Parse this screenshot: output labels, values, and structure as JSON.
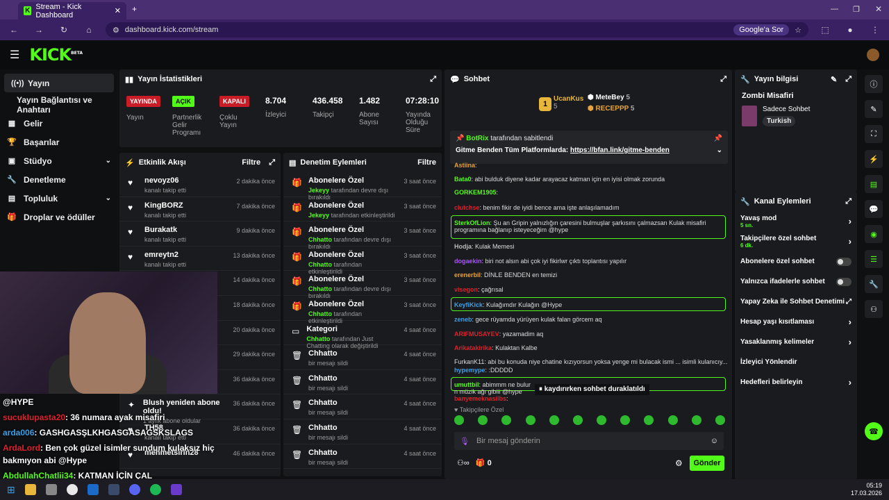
{
  "browser": {
    "tab_title": "Stream - Kick Dashboard",
    "url": "dashboard.kick.com/stream",
    "search_chip": "Google'a Sor"
  },
  "header": {
    "logo": "KICK",
    "beta": "BETA"
  },
  "sidebar": {
    "items": [
      {
        "label": "Yayın",
        "icon": "broadcast-icon"
      },
      {
        "label": "Yayın Bağlantısı ve Anahtarı"
      },
      {
        "label": "Gelir",
        "icon": "revenue-icon"
      },
      {
        "label": "Başarılar",
        "icon": "trophy-icon"
      },
      {
        "label": "Stüdyo",
        "icon": "studio-icon"
      },
      {
        "label": "Denetleme",
        "icon": "wrench-icon"
      },
      {
        "label": "Topluluk",
        "icon": "community-icon"
      },
      {
        "label": "Droplar ve ödüller",
        "icon": "gift-icon"
      }
    ]
  },
  "stats": {
    "title": "Yayın İstatistikleri",
    "items": [
      {
        "badge": "YAYINDA",
        "label": "Yayın",
        "color": "#e0202a"
      },
      {
        "badge": "AÇIK",
        "label": "Partnerlik Gelir Programı",
        "color": "#53fc18"
      },
      {
        "badge": "KAPALI",
        "label": "Çoklu Yayın",
        "color": "#e0202a"
      },
      {
        "value": "8.704",
        "label": "İzleyici"
      },
      {
        "value": "436.458",
        "label": "Takipçi"
      },
      {
        "value": "1.482",
        "label": "Abone Sayısı"
      },
      {
        "value": "07:28:10",
        "label": "Yayında Olduğu Süre"
      }
    ]
  },
  "activity": {
    "title": "Etkinlik Akışı",
    "filter": "Filtre",
    "rows": [
      {
        "name": "nevoyz06",
        "sub": "kanalı takip etti",
        "time": "2 dakika önce"
      },
      {
        "name": "KingBORZ",
        "sub": "kanalı takip etti",
        "time": "7 dakika önce"
      },
      {
        "name": "Burakatk",
        "sub": "kanalı takip etti",
        "time": "9 dakika önce"
      },
      {
        "name": "emreytn2",
        "sub": "kanalı takip etti",
        "time": "13 dakika önce"
      },
      {
        "name": "",
        "sub": "",
        "time": "14 dakika önce"
      },
      {
        "name": "",
        "sub": "",
        "time": "18 dakika önce"
      },
      {
        "name": "",
        "sub": "",
        "time": "20 dakika önce"
      },
      {
        "name": "",
        "sub": "",
        "time": "29 dakika önce"
      },
      {
        "name": "lu!",
        "sub": "",
        "time": "36 dakika önce"
      },
      {
        "name": "Blush yeniden abone oldu!",
        "sub": "1 aylık abone oldular",
        "time": "36 dakika önce"
      },
      {
        "name": "TH58",
        "sub": "kanalı takip etti",
        "time": "36 dakika önce"
      },
      {
        "name": "mehmetsirin28",
        "sub": "",
        "time": "46 dakika önce"
      }
    ]
  },
  "moderation": {
    "title": "Denetim Eylemleri",
    "filter": "Filtre",
    "rows": [
      {
        "name": "Abonelere Özel",
        "user": "Jekeyy",
        "sub": "tarafından devre dışı bırakıldı",
        "time": "3 saat önce"
      },
      {
        "name": "Abonelere Özel",
        "user": "Jekeyy",
        "sub": "tarafından etkinleştirildi",
        "time": "3 saat önce"
      },
      {
        "name": "Abonelere Özel",
        "user": "Chhatto",
        "sub": "tarafından devre dışı bırakıldı",
        "time": "3 saat önce"
      },
      {
        "name": "Abonelere Özel",
        "user": "Chhatto",
        "sub": "tarafından etkinleştirildi",
        "time": "3 saat önce"
      },
      {
        "name": "Abonelere Özel",
        "user": "Chhatto",
        "sub": "tarafından devre dışı bırakıldı",
        "time": "3 saat önce"
      },
      {
        "name": "Abonelere Özel",
        "user": "Chhatto",
        "sub": "tarafından etkinleştirildi",
        "time": "3 saat önce"
      },
      {
        "name": "Kategori",
        "user": "Chhatto",
        "sub": "tarafından Just Chatting olarak değiştirildi",
        "time": "4 saat önce"
      },
      {
        "name": "Chhatto",
        "user": "",
        "sub": "bir mesajı sildi",
        "time": "4 saat önce"
      },
      {
        "name": "Chhatto",
        "user": "",
        "sub": "bir mesajı sildi",
        "time": "4 saat önce"
      },
      {
        "name": "Chhatto",
        "user": "",
        "sub": "bir mesajı sildi",
        "time": "4 saat önce"
      },
      {
        "name": "Chhatto",
        "user": "",
        "sub": "bir mesajı sildi",
        "time": "4 saat önce"
      },
      {
        "name": "Chhatto",
        "user": "",
        "sub": "bir mesajı sildi",
        "time": "4 saat önce"
      }
    ]
  },
  "chat": {
    "title": "Sohbet",
    "leaders": [
      {
        "rank": "1",
        "name": "UcanKus",
        "count": "5"
      },
      {
        "name": "MeteBey",
        "count": "5"
      },
      {
        "name": "RECEPPP",
        "count": "5"
      }
    ],
    "pinned": {
      "by": "BotRix",
      "by_suffix": "tarafından sabitlendi",
      "text": "Gitme Benden Tüm Platformlarda: ",
      "link": "https://bfan.link/gitme-benden"
    },
    "messages": [
      {
        "user": "Astiina",
        "text": "",
        "color": "#e8a33a"
      },
      {
        "user": "Bata0",
        "text": "abi bulduk diyene kadar arayacaz katman için en iyisi olmak zorunda",
        "color": "#53fc18"
      },
      {
        "user": "GORKEM1905",
        "text": "",
        "color": "#53fc18"
      },
      {
        "user": "clutchse",
        "text": "benim fikir de iyidi bence ama işte anlaşılamadım",
        "color": "#e0202a"
      },
      {
        "user": "SterkOfLion",
        "text": "Şu an Gripin yalnızlığın çaresini bulmuşlar şarkısını çalmazsan Kulak misafiri",
        "text2": "programına bağlanıp isteyeceğim @hype",
        "color": "#53fc18"
      },
      {
        "user": "Hodja",
        "text": "Kulak Memesi",
        "color": "#bbb"
      },
      {
        "user": "dogaekin",
        "text": "biri not alsın abi çok iyi fikirlwr çıktı toplantısı yapılır",
        "color": "#a855f7"
      },
      {
        "user": "erenerbil",
        "text": "DİNLE BENDEN en temizi",
        "color": "#e8a33a"
      },
      {
        "user": "visegon",
        "text": "çağrısal",
        "color": "#e0202a"
      },
      {
        "user": "KeyfiKick",
        "text": "Kulağımdır Kulağın @Hype",
        "color": "#3aa0e8"
      },
      {
        "user": "zeneb",
        "text": "gece rüyamda yürüyen kulak falan görcem aq",
        "color": "#3aa0e8"
      },
      {
        "user": "ARIFMUSAYEV",
        "text": "yazamadim aq",
        "color": "#e0202a"
      },
      {
        "user": "Arikatakirika",
        "text": "Kulaktan Kalbe",
        "color": "#e0202a"
      },
      {
        "user": "",
        "text": "FurkanK11: abi bu konuda niye chatine kızıyorsun yoksa yenge mi bulacak ismi ... isimli kulanıcıy...",
        "color": "#888"
      },
      {
        "user": "hypemype",
        "text": ":DDDDD",
        "color": "#3aa0e8"
      },
      {
        "user": "umuttbil",
        "text": "abimmm ne bulur",
        "text2": "n müzik ağı gibiii @hype",
        "color": "#53fc18"
      },
      {
        "user": "banyemeknasilbs",
        "text": "",
        "color": "#e0202a"
      }
    ],
    "paused": "kaydırırken sohbet duraklatıldı",
    "followers_only": "Takipçilere Özel",
    "placeholder": "Bir mesaj gönderin",
    "count": "0",
    "send": "Gönder"
  },
  "stream_info": {
    "title": "Yayın bilgisi",
    "name": "Zombi Misafiri",
    "category": "Sadece Sohbet",
    "tag": "Turkish"
  },
  "channel_actions": {
    "title": "Kanal Eylemleri",
    "items": [
      {
        "label": "Yavaş mod",
        "sub": "5 sn.",
        "type": "chev"
      },
      {
        "label": "Takipçilere özel sohbet",
        "sub": "6 dk.",
        "type": "chev"
      },
      {
        "label": "Abonelere özel sohbet",
        "type": "toggle"
      },
      {
        "label": "Yalnızca ifadelerle sohbet",
        "type": "toggle"
      },
      {
        "label": "Yapay Zeka ile Sohbet Denetimi",
        "type": "ext"
      },
      {
        "label": "Hesap yaşı kısıtlaması",
        "type": "chev"
      },
      {
        "label": "Yasaklanmış kelimeler",
        "type": "chev"
      },
      {
        "label": "İzleyici Yönlendir",
        "type": "none"
      },
      {
        "label": "Hedefleri belirleyin",
        "type": "chev"
      }
    ]
  },
  "overlay": {
    "lines": [
      {
        "user": "",
        "text": "@HYPE"
      },
      {
        "user": "sucukIupasta20",
        "text": ": 36 numara ayak misafiri",
        "color": "#e0202a"
      },
      {
        "user": "arda006",
        "text": ": GASHGASŞLKHGASGASAGSKSLAGS",
        "color": "#3aa0e8"
      },
      {
        "user": "ArdaLord",
        "text": ": Ben çok güzel isimler sundum kulaksız hiç",
        "color": "#e0202a"
      },
      {
        "user": "",
        "text": "bakmıyon abi @Hype"
      },
      {
        "user": "AbdullahChatlii34",
        "text": ": KATMAN İÇİN ÇAL",
        "color": "#53fc18"
      }
    ]
  },
  "taskbar": {
    "time": "05:19",
    "date": "17.03.2026"
  }
}
